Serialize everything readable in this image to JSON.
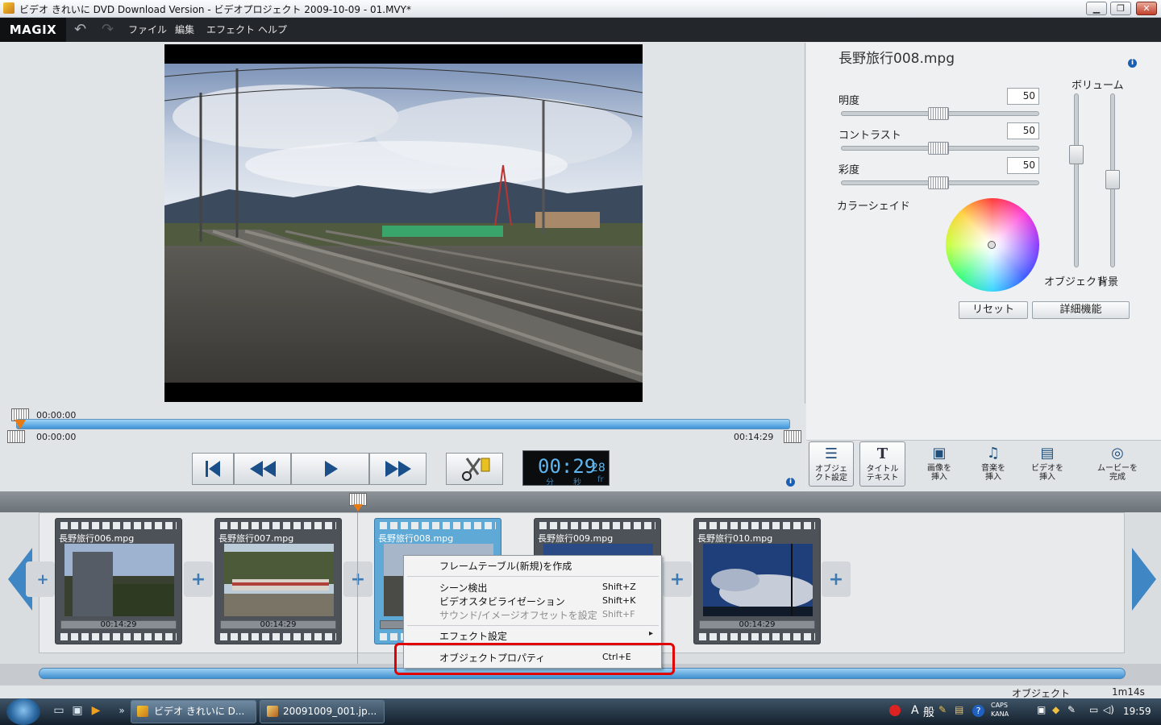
{
  "window": {
    "title": "ビデオ きれいに DVD Download Version - ビデオプロジェクト 2009-10-09 - 01.MVY*",
    "minimize": "▁",
    "maximize": "❐",
    "close": "✕"
  },
  "menubar": {
    "logo": "MAGIX",
    "items": [
      "ファイル",
      "編集",
      "エフェクト",
      "ヘルプ"
    ]
  },
  "scrubber": {
    "position_top": "00:00:00",
    "range_start": "00:00:00",
    "range_end": "00:14:29"
  },
  "transport": {
    "timecode_main": "00:29",
    "timecode_frames": "28",
    "unit_min": "分",
    "unit_sec": "秒",
    "unit_frame": "fr"
  },
  "properties": {
    "file_name": "長野旅行008.mpg",
    "brightness_label": "明度",
    "brightness_value": "50",
    "contrast_label": "コントラスト",
    "contrast_value": "50",
    "saturation_label": "彩度",
    "saturation_value": "50",
    "color_shade_label": "カラーシェイド",
    "volume_label": "ボリューム",
    "volume_object_label": "オブジェクト",
    "volume_background_label": "背景",
    "reset_button": "リセット",
    "advanced_button": "詳細機能"
  },
  "tools": [
    {
      "label1": "オブジェ",
      "label2": "クト設定",
      "icon": "sliders-icon"
    },
    {
      "label1": "タイトル",
      "label2": "テキスト",
      "icon": "text-icon"
    },
    {
      "label1": "画像を",
      "label2": "挿入",
      "icon": "image-insert-icon"
    },
    {
      "label1": "音楽を",
      "label2": "挿入",
      "icon": "music-insert-icon"
    },
    {
      "label1": "ビデオを",
      "label2": "挿入",
      "icon": "video-insert-icon"
    },
    {
      "label1": "ムービーを",
      "label2": "完成",
      "icon": "disc-icon"
    }
  ],
  "clips": [
    {
      "name": "長野旅行006.mpg",
      "duration": "00:14:29"
    },
    {
      "name": "長野旅行007.mpg",
      "duration": "00:14:29"
    },
    {
      "name": "長野旅行008.mpg",
      "duration": ""
    },
    {
      "name": "長野旅行009.mpg",
      "duration": ""
    },
    {
      "name": "長野旅行010.mpg",
      "duration": "00:14:29"
    }
  ],
  "context_menu": {
    "items": [
      {
        "label": "フレームテーブル(新規)を作成",
        "shortcut": ""
      },
      {
        "label": "シーン検出",
        "shortcut": "Shift+Z"
      },
      {
        "label": "ビデオスタビライゼーション",
        "shortcut": "Shift+K"
      },
      {
        "label": "サウンド/イメージオフセットを設定",
        "shortcut": "Shift+F",
        "disabled": true
      },
      {
        "label": "エフェクト設定",
        "shortcut": "▸"
      },
      {
        "label": "オブジェクトプロパティ",
        "shortcut": "Ctrl+E"
      }
    ]
  },
  "statusbar": {
    "mode": "オブジェクト",
    "length": "1m14s"
  },
  "taskbar": {
    "tasks": [
      "ビデオ きれいに D...",
      "20091009_001.jp..."
    ],
    "overflow": "»",
    "ime_a": "A",
    "ime_mode": "般",
    "caps": "CAPS",
    "kana": "KANA",
    "clock": "19:59"
  },
  "colors": {
    "accent_blue": "#3d94d8",
    "highlight_red": "#e00000",
    "menubar_dark": "#23272c"
  }
}
